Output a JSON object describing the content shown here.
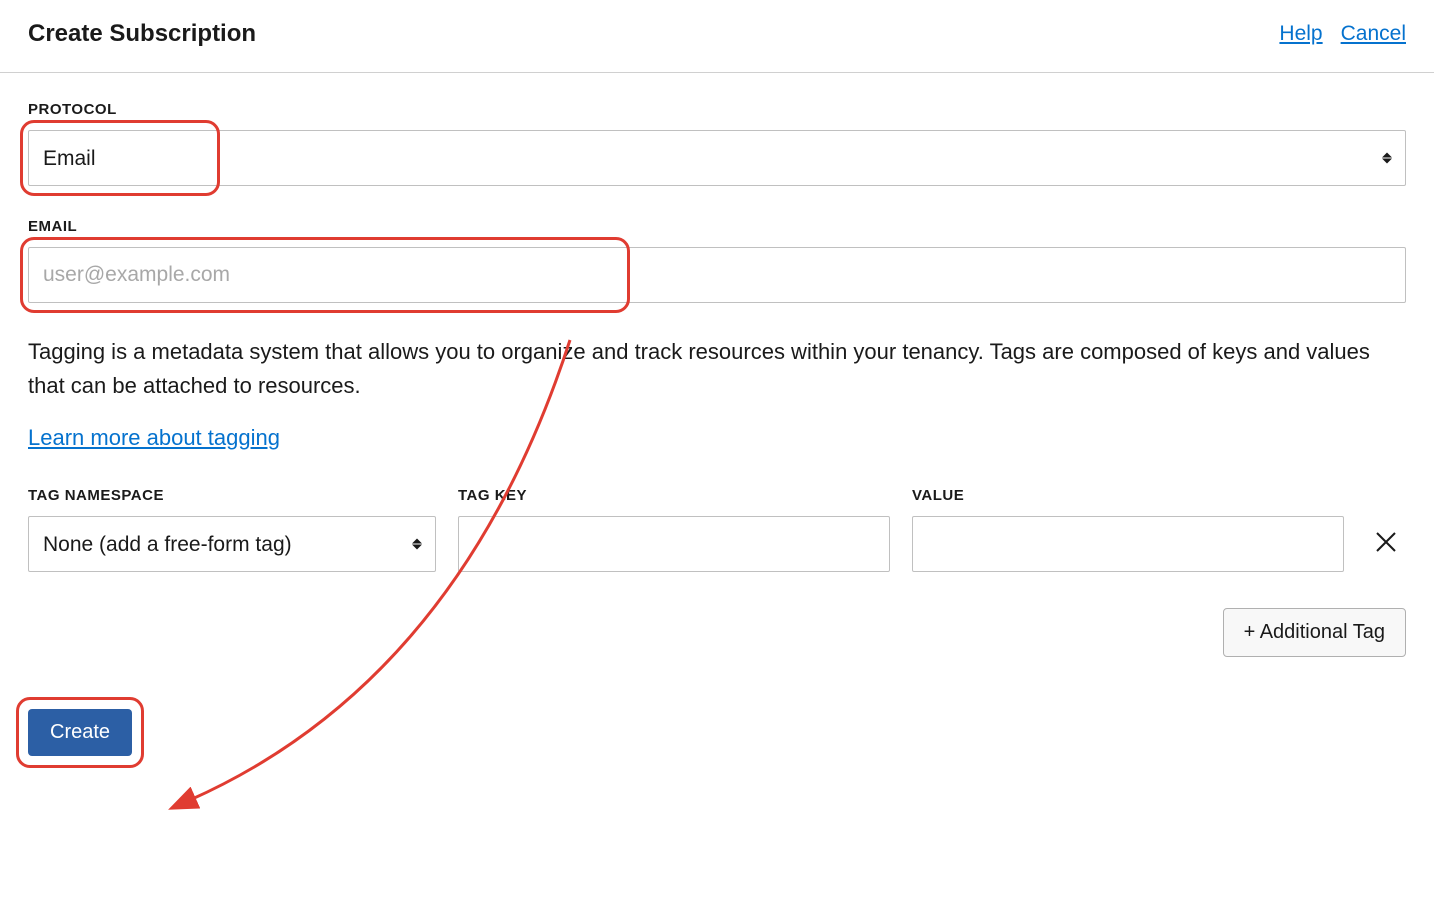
{
  "header": {
    "title": "Create Subscription",
    "help_label": "Help",
    "cancel_label": "Cancel"
  },
  "form": {
    "protocol_label": "PROTOCOL",
    "protocol_value": "Email",
    "email_label": "EMAIL",
    "email_placeholder": "user@example.com"
  },
  "tagging": {
    "description": "Tagging is a metadata system that allows you to organize and track resources within your tenancy. Tags are composed of keys and values that can be attached to resources.",
    "learn_label": "Learn more about tagging",
    "namespace_label": "TAG NAMESPACE",
    "namespace_value": "None (add a free-form tag)",
    "key_label": "TAG KEY",
    "value_label": "VALUE",
    "add_tag_label": "+ Additional Tag"
  },
  "actions": {
    "create_label": "Create"
  }
}
